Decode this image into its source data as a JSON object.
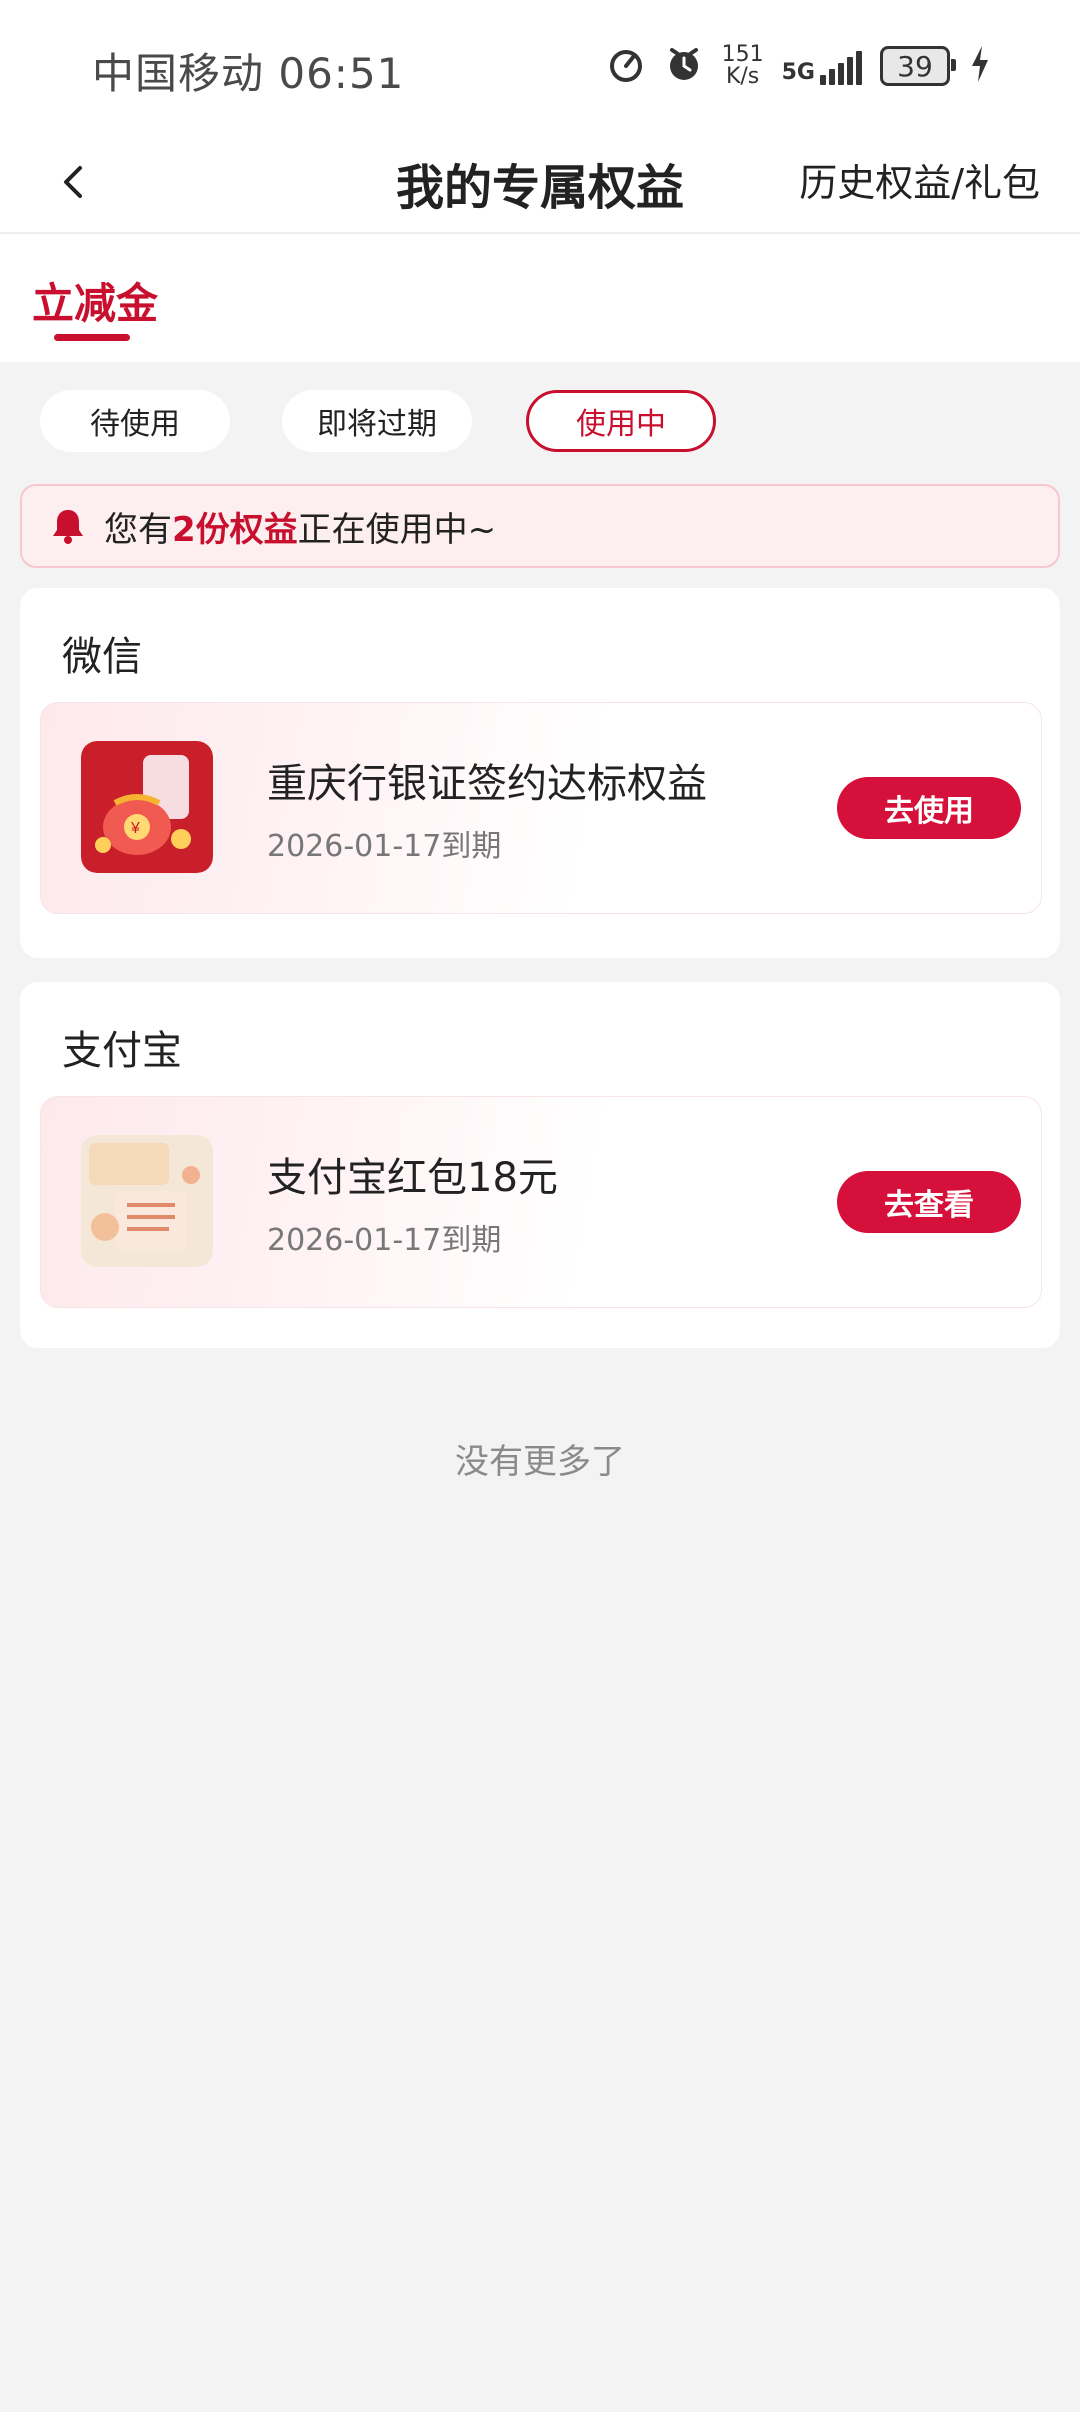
{
  "status_bar": {
    "carrier_time": "中国移动 06:51",
    "net_speed_top": "151",
    "net_speed_bottom": "K/s",
    "network": "5G",
    "battery": "39"
  },
  "header": {
    "title": "我的专属权益",
    "right_link": "历史权益/礼包"
  },
  "tabs": {
    "active_label": "立减金"
  },
  "filters": [
    {
      "label": "待使用",
      "active": false
    },
    {
      "label": "即将过期",
      "active": false
    },
    {
      "label": "使用中",
      "active": true
    }
  ],
  "notice": {
    "prefix": "您有",
    "highlight": "2份权益",
    "suffix": "正在使用中~"
  },
  "cards": [
    {
      "title": "微信",
      "item": {
        "name": "重庆行银证签约达标权益",
        "expire": "2026-01-17到期",
        "button": "去使用"
      }
    },
    {
      "title": "支付宝",
      "item": {
        "name": "支付宝红包18元",
        "expire": "2026-01-17到期",
        "button": "去查看"
      }
    }
  ],
  "footer_text": "没有更多了",
  "colors": {
    "accent": "#c8102e",
    "button": "#d5103a",
    "background": "#f3f3f3"
  },
  "icons": {
    "back": "back-icon",
    "bell": "bell-icon",
    "speed": "speedometer-icon",
    "alarm": "alarm-icon",
    "signal": "signal-icon",
    "battery": "battery-icon",
    "charging": "charging-icon"
  }
}
